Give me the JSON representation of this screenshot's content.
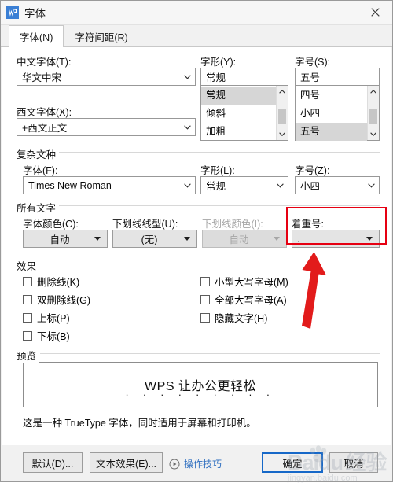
{
  "window": {
    "title": "字体",
    "app_icon": "wps-writer-icon",
    "close_label": "×"
  },
  "tabs": [
    {
      "label": "字体(N)",
      "active": true
    },
    {
      "label": "字符间距(R)",
      "active": false
    }
  ],
  "latin_group": {
    "chinese_font": {
      "label": "中文字体(T):",
      "value": "华文中宋"
    },
    "western_font": {
      "label": "西文字体(X):",
      "value": "+西文正文"
    },
    "style": {
      "label": "字形(Y):",
      "value": "常规",
      "options": [
        "常规",
        "倾斜",
        "加粗"
      ],
      "selected": "常规"
    },
    "size": {
      "label": "字号(S):",
      "value": "五号",
      "options": [
        "四号",
        "小四",
        "五号"
      ],
      "selected": "五号"
    }
  },
  "complex_group": {
    "title": "复杂文种",
    "font": {
      "label": "字体(F):",
      "value": "Times New Roman"
    },
    "style": {
      "label": "字形(L):",
      "value": "常规"
    },
    "size": {
      "label": "字号(Z):",
      "value": "小四"
    }
  },
  "all_text_group": {
    "title": "所有文字",
    "font_color": {
      "label": "字体颜色(C):",
      "value": "自动",
      "disabled": false
    },
    "underline_style": {
      "label": "下划线线型(U):",
      "value": "(无)",
      "disabled": false
    },
    "underline_color": {
      "label": "下划线颜色(I):",
      "value": "自动",
      "disabled": true
    },
    "emphasis_mark": {
      "label": "着重号:",
      "value": ".",
      "disabled": false,
      "highlighted": true
    }
  },
  "effects_group": {
    "title": "效果",
    "left_column": [
      {
        "label": "删除线(K)",
        "checked": false
      },
      {
        "label": "双删除线(G)",
        "checked": false
      },
      {
        "label": "上标(P)",
        "checked": false
      },
      {
        "label": "下标(B)",
        "checked": false
      }
    ],
    "right_column": [
      {
        "label": "小型大写字母(M)",
        "checked": false
      },
      {
        "label": "全部大写字母(A)",
        "checked": false
      },
      {
        "label": "隐藏文字(H)",
        "checked": false
      }
    ]
  },
  "preview_group": {
    "title": "预览",
    "sample_text": "WPS 让办公更轻松",
    "emphasis_dots": ". . . . . . . . .",
    "note": "这是一种 TrueType 字体，同时适用于屏幕和打印机。"
  },
  "footer": {
    "default_button": "默认(D)...",
    "text_effects_button": "文本效果(E)...",
    "tips_link": "操作技巧",
    "tips_icon": "play-circle-icon",
    "ok_button": "确定",
    "cancel_button": "取消"
  },
  "annotations": {
    "highlight_color": "#e60012",
    "arrow_color": "#e21b1b",
    "target": "着重号"
  },
  "watermark": {
    "brand": "Baidu",
    "suffix": "经验",
    "url": "jingyan.baidu.com"
  }
}
